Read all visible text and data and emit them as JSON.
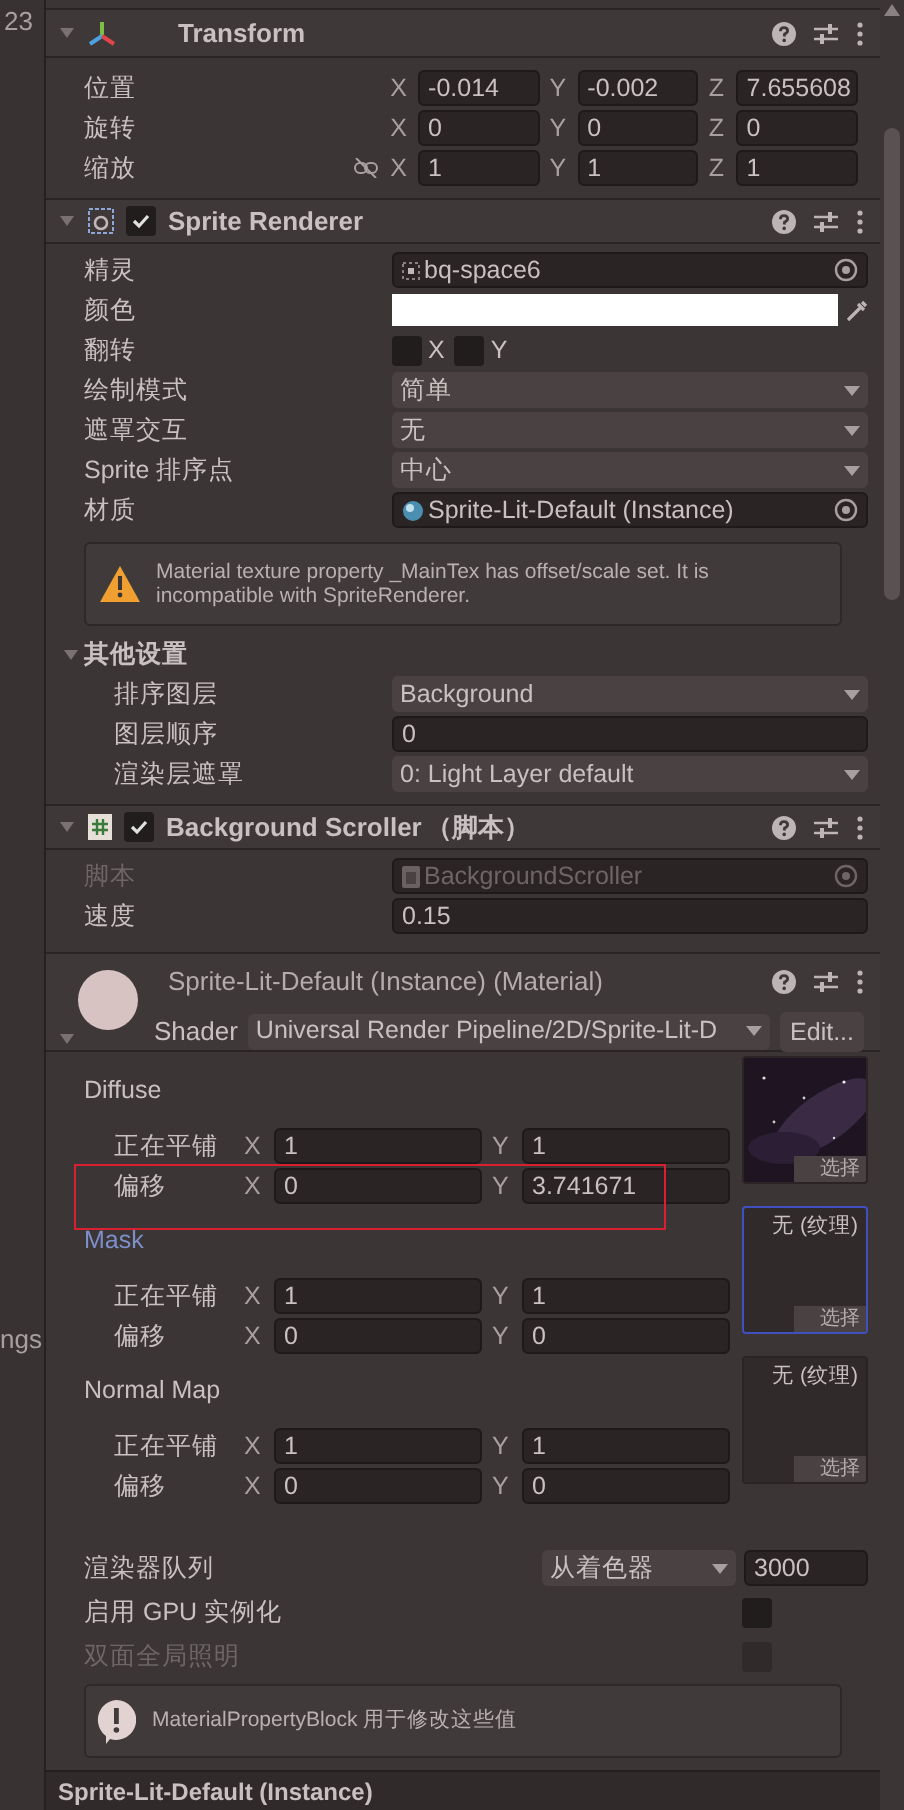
{
  "left_panel": {
    "texts": [
      "23",
      "ngs"
    ]
  },
  "transform": {
    "title": "Transform",
    "expanded": true,
    "rows": [
      {
        "label": "位置",
        "fields": [
          {
            "axis": "X",
            "value": "-0.014"
          },
          {
            "axis": "Y",
            "value": "-0.002"
          },
          {
            "axis": "Z",
            "value": "7.655608"
          }
        ]
      },
      {
        "label": "旋转",
        "fields": [
          {
            "axis": "X",
            "value": "0"
          },
          {
            "axis": "Y",
            "value": "0"
          },
          {
            "axis": "Z",
            "value": "0"
          }
        ]
      },
      {
        "label": "缩放",
        "proportions_locked": false,
        "fields": [
          {
            "axis": "X",
            "value": "1"
          },
          {
            "axis": "Y",
            "value": "1"
          },
          {
            "axis": "Z",
            "value": "1"
          }
        ]
      }
    ]
  },
  "sprite_renderer": {
    "title": "Sprite Renderer",
    "enabled": true,
    "expanded": true,
    "rows": [
      {
        "kind": "sprite_ref",
        "label": "精灵",
        "value": "bq-space6"
      },
      {
        "kind": "color",
        "label": "颜色",
        "color": "#ffffff"
      },
      {
        "kind": "flip",
        "label": "翻转",
        "toggles": [
          {
            "label": "X",
            "checked": false
          },
          {
            "label": "Y",
            "checked": false
          }
        ]
      },
      {
        "kind": "dropdown",
        "label": "绘制模式",
        "value": "简单"
      },
      {
        "kind": "dropdown",
        "label": "遮罩交互",
        "value": "无"
      },
      {
        "kind": "dropdown",
        "label": "Sprite 排序点",
        "value": "中心"
      },
      {
        "kind": "material_ref",
        "label": "材质",
        "value": "Sprite-Lit-Default (Instance)"
      }
    ],
    "warning": "Material texture property _MainTex has offset/scale set. It is incompatible with SpriteRenderer.",
    "additional": {
      "title": "其他设置",
      "expanded": true,
      "rows": [
        {
          "kind": "dropdown",
          "label": "排序图层",
          "value": "Background"
        },
        {
          "kind": "number",
          "label": "图层顺序",
          "value": "0"
        },
        {
          "kind": "dropdown",
          "label": "渲染层遮罩",
          "value": "0: Light Layer default"
        }
      ]
    }
  },
  "script": {
    "title": "Background Scroller",
    "suffix": "（脚本）",
    "enabled": true,
    "expanded": true,
    "rows": [
      {
        "kind": "script_ref",
        "label": "脚本",
        "value": "BackgroundScroller",
        "disabled": true
      },
      {
        "kind": "number",
        "label": "速度",
        "value": "0.15",
        "disabled": false
      }
    ]
  },
  "material": {
    "title": "Sprite-Lit-Default (Instance) (Material)",
    "expanded": true,
    "shader_label": "Shader",
    "shader": "Universal Render Pipeline/2D/Sprite-Lit-D",
    "edit_button": "Edit...",
    "textures": [
      {
        "name": "Diffuse",
        "selected": false,
        "texture": {
          "kind": "picture"
        },
        "select_button": "选择",
        "rows": [
          {
            "label": "正在平铺",
            "highlighted": false,
            "fields": [
              {
                "axis": "X",
                "value": "1"
              },
              {
                "axis": "Y",
                "value": "1"
              }
            ]
          },
          {
            "label": "偏移",
            "highlighted": true,
            "fields": [
              {
                "axis": "X",
                "value": "0"
              },
              {
                "axis": "Y",
                "value": "3.741671"
              }
            ]
          }
        ]
      },
      {
        "name": "Mask",
        "selected": true,
        "texture": {
          "kind": "empty",
          "text": "无 (纹理)"
        },
        "select_button": "选择",
        "rows": [
          {
            "label": "正在平铺",
            "highlighted": false,
            "fields": [
              {
                "axis": "X",
                "value": "1"
              },
              {
                "axis": "Y",
                "value": "1"
              }
            ]
          },
          {
            "label": "偏移",
            "highlighted": false,
            "fields": [
              {
                "axis": "X",
                "value": "0"
              },
              {
                "axis": "Y",
                "value": "0"
              }
            ]
          }
        ]
      },
      {
        "name": "Normal Map",
        "selected": false,
        "texture": {
          "kind": "empty",
          "text": "无 (纹理)"
        },
        "select_button": "选择",
        "rows": [
          {
            "label": "正在平铺",
            "highlighted": false,
            "fields": [
              {
                "axis": "X",
                "value": "1"
              },
              {
                "axis": "Y",
                "value": "1"
              }
            ]
          },
          {
            "label": "偏移",
            "highlighted": false,
            "fields": [
              {
                "axis": "X",
                "value": "0"
              },
              {
                "axis": "Y",
                "value": "0"
              }
            ]
          }
        ]
      }
    ],
    "queue": {
      "label": "渲染器队列",
      "mode": "从着色器",
      "value": "3000"
    },
    "toggles": [
      {
        "label": "启用 GPU 实例化",
        "checked": false,
        "disabled": false
      },
      {
        "label": "双面全局照明",
        "checked": false,
        "disabled": true
      }
    ],
    "info": "MaterialPropertyBlock 用于修改这些值"
  },
  "preview_bar": {
    "title": "Sprite-Lit-Default (Instance)"
  }
}
